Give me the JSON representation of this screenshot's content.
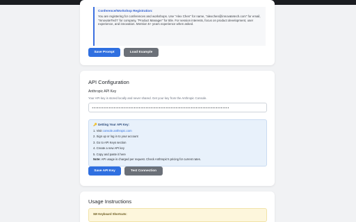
{
  "prompt_example": {
    "title": "Conference/Workshop Registration:",
    "body": "You are registering for conferences and workshops. Use \"Alex Chen\" for name, \"alexchen@innovatetech.com\" for email, \"InnovateTech\" for company, \"Product Manager\" for title. For session interests, focus on product development, user experience, and innovation. Mention 5+ years experience when asked."
  },
  "prompt_actions": {
    "save_label": "Save Prompt",
    "load_label": "Load Example"
  },
  "api": {
    "section_title": "API Configuration",
    "key_label": "Anthropic API Key",
    "key_help": "Your API key is stored locally and never shared. Get your key from the Anthropic Console.",
    "key_value": "••••••••••••••••••••••••••••••••••••••••••••••••••••••••••••••••••••••••••••••••••",
    "info": {
      "heading": "Getting Your API Key:",
      "steps": [
        {
          "prefix": "1. Visit ",
          "link": "console.anthropic.com"
        },
        {
          "prefix": "2. Sign up or log in to your account"
        },
        {
          "prefix": "3. Go to API Keys section"
        },
        {
          "prefix": "4. Create a new API key"
        },
        {
          "prefix": "5. Copy and paste it here"
        }
      ],
      "note_label": "Note:",
      "note_text": "API usage is charged per request. Check Anthropic's pricing for current rates."
    },
    "save_label": "Save API Key",
    "test_label": "Test Connection"
  },
  "usage": {
    "section_title": "Usage Instructions",
    "shortcuts_heading": "Keyboard Shortcuts:"
  },
  "colors": {
    "primary": "#2f6fe0",
    "secondary": "#6b7078",
    "info_bg": "#e8f1fb",
    "warn_bg": "#fdf6dc"
  }
}
